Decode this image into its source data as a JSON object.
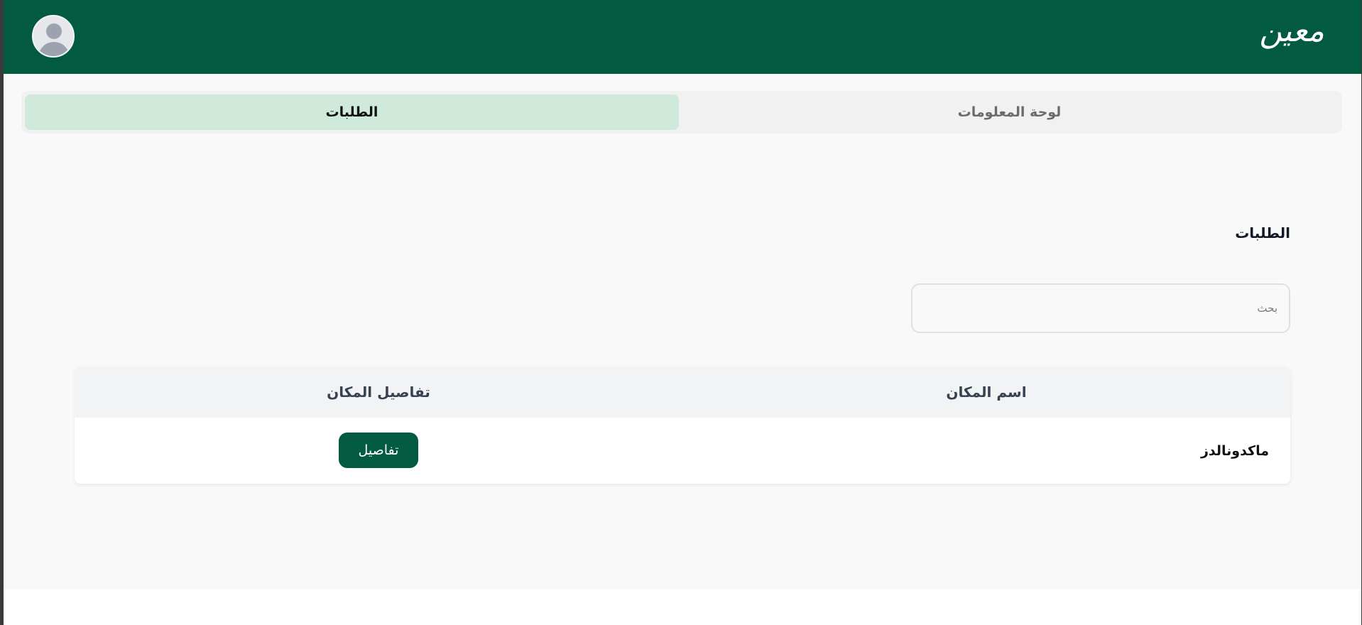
{
  "header": {
    "logo_text": "معين",
    "avatar_icon": "user-avatar-icon",
    "brand_color": "#025b41"
  },
  "tabs": [
    {
      "label": "لوحة المعلومات",
      "active": false
    },
    {
      "label": "الطلبات",
      "active": true
    }
  ],
  "page": {
    "section_title": "الطلبات"
  },
  "search": {
    "placeholder": "بحث",
    "value": ""
  },
  "table": {
    "columns": [
      "اسم المكان",
      "تفاصيل المكان"
    ],
    "rows": [
      {
        "name": "ماكدونالدز",
        "action_label": "تفاصيل"
      }
    ]
  }
}
